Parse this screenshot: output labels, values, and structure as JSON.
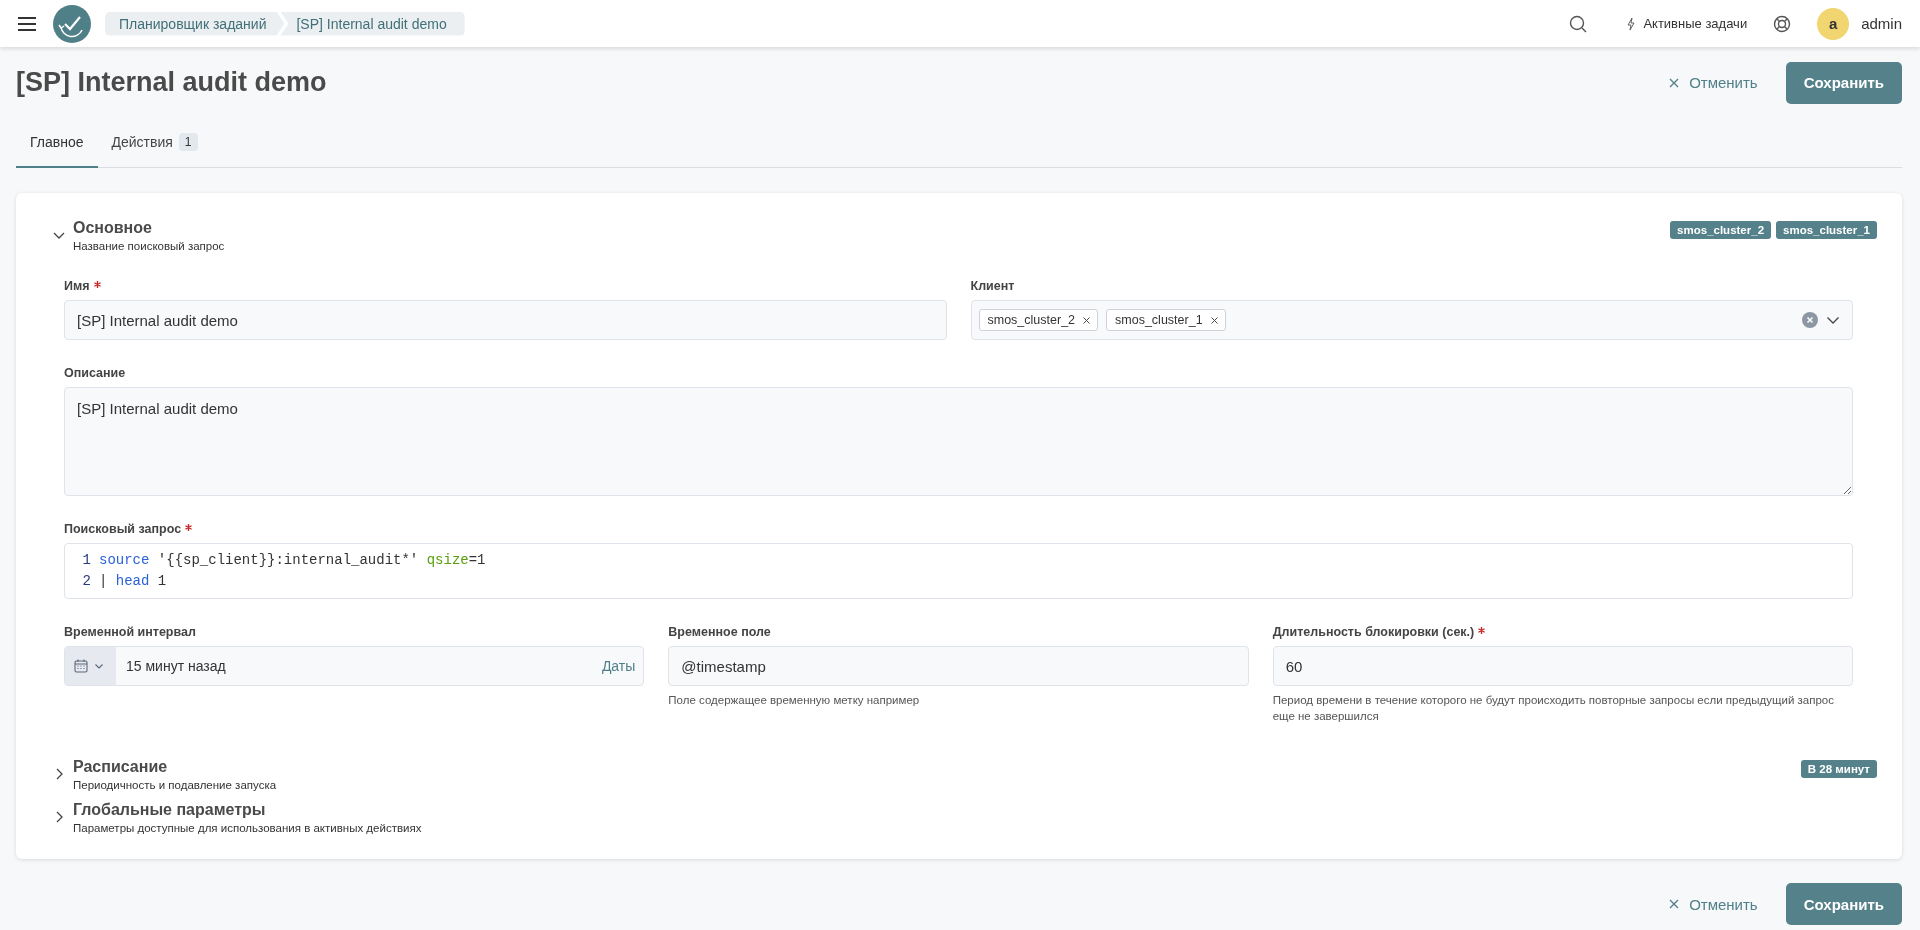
{
  "header": {
    "breadcrumbs": [
      {
        "label": "Планировщик заданий"
      },
      {
        "label": "[SP] Internal audit demo"
      }
    ],
    "active_tasks": "Активные задачи",
    "user": {
      "initial": "a",
      "name": "admin"
    }
  },
  "page": {
    "title": "[SP] Internal audit demo",
    "cancel": "Отменить",
    "save": "Сохранить"
  },
  "tabs": [
    {
      "label": "Главное",
      "selected": true
    },
    {
      "label": "Действия",
      "count": "1",
      "selected": false
    }
  ],
  "sections": [
    {
      "title": "Основное",
      "subtitle": "Название поисковый запрос",
      "expanded": true,
      "badges": [
        "smos_cluster_2",
        "smos_cluster_1"
      ],
      "rows": [
        [
          {
            "kind": "text",
            "label": "Имя",
            "required": true,
            "value": "[SP] Internal audit demo"
          },
          {
            "kind": "multiselect",
            "label": "Клиент",
            "required": false,
            "chips": [
              "smos_cluster_2",
              "smos_cluster_1"
            ]
          }
        ],
        [
          {
            "kind": "textarea",
            "label": "Описание",
            "required": false,
            "value": "[SP] Internal audit demo"
          }
        ],
        [
          {
            "kind": "code",
            "label": "Поисковый запрос",
            "required": true,
            "lines": [
              {
                "number": "1",
                "tokens": [
                  {
                    "kind": "keyword",
                    "text": "source"
                  },
                  {
                    "kind": "plain",
                    "text": " '{{sp_client}}:internal_audit*' "
                  },
                  {
                    "kind": "param",
                    "text": "qsize"
                  },
                  {
                    "kind": "plain",
                    "text": "=1"
                  }
                ]
              },
              {
                "number": "2",
                "tokens": [
                  {
                    "kind": "plain",
                    "text": "| "
                  },
                  {
                    "kind": "keyword",
                    "text": "head"
                  },
                  {
                    "kind": "plain",
                    "text": " 1"
                  }
                ]
              }
            ]
          }
        ],
        [
          {
            "kind": "timerange",
            "label": "Временной интервал",
            "required": false,
            "value": "15 минут назад",
            "link": "Даты"
          },
          {
            "kind": "text",
            "label": "Временное поле",
            "required": false,
            "value": "@timestamp",
            "hint": "Поле содержащее временную метку например"
          },
          {
            "kind": "text",
            "label": "Длительность блокировки (сек.)",
            "required": true,
            "value": "60",
            "hint": "Период времени в течение которого не будут происходить повторные запросы если предыдущий запрос еще не завершился"
          }
        ]
      ]
    },
    {
      "title": "Расписание",
      "subtitle": "Периодичность и подавление запуска",
      "expanded": false,
      "badges": [
        "В 28 минут"
      ]
    },
    {
      "title": "Глобальные параметры",
      "subtitle": "Параметры доступные для использования в активных действиях",
      "expanded": false
    }
  ],
  "footer": {
    "cancel": "Отменить",
    "save": "Сохранить"
  }
}
